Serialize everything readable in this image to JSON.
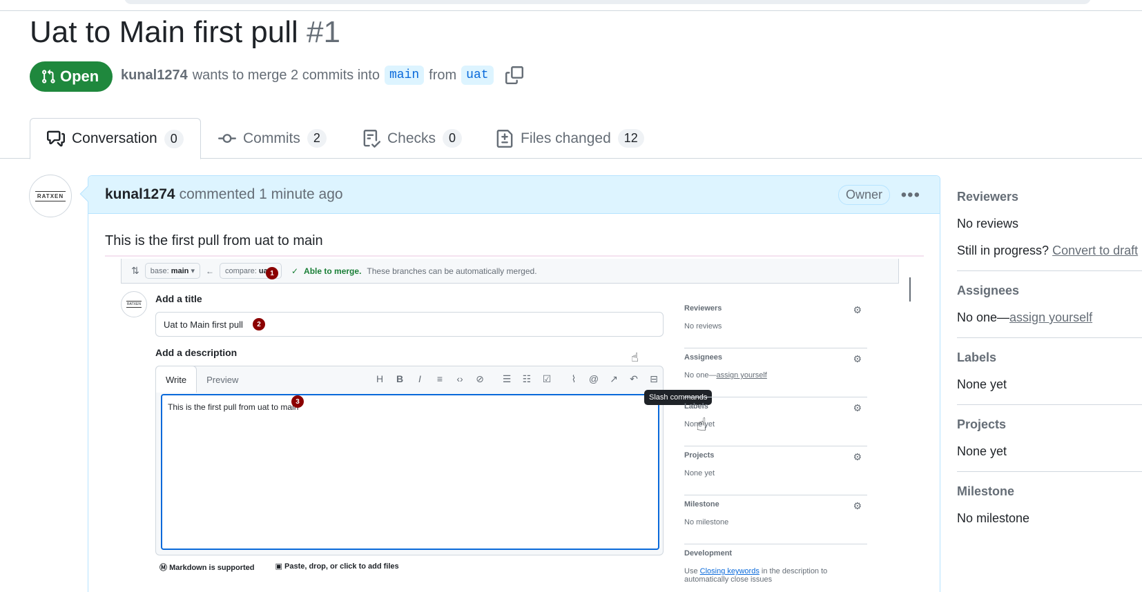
{
  "pr": {
    "title": "Uat to Main first pull",
    "number": "#1",
    "state": "Open",
    "author": "kunal1274",
    "merge_text": "wants to merge 2 commits into",
    "base_branch": "main",
    "from_text": "from",
    "head_branch": "uat"
  },
  "tabs": [
    {
      "label": "Conversation",
      "count": "0"
    },
    {
      "label": "Commits",
      "count": "2"
    },
    {
      "label": "Checks",
      "count": "0"
    },
    {
      "label": "Files changed",
      "count": "12"
    }
  ],
  "comment": {
    "author": "kunal1274",
    "action": "commented 1 minute ago",
    "role": "Owner",
    "body": "This is the first pull from uat to main",
    "avatar_text": "RATXEN"
  },
  "screenshot": {
    "base_label": "base:",
    "base_value": "main",
    "compare_label": "compare:",
    "compare_value": "uat",
    "merge_status": "Able to merge.",
    "merge_note": "These branches can be automatically merged.",
    "add_title": "Add a title",
    "title_value": "Uat to Main first pull",
    "add_description": "Add a description",
    "tab_write": "Write",
    "tab_preview": "Preview",
    "description_value": "This is the first pull from uat to main",
    "tooltip": "Slash commands",
    "markdown_note": "Markdown is supported",
    "files_note": "Paste, drop, or click to add files",
    "badges": [
      "1",
      "2",
      "3"
    ],
    "side": [
      {
        "title": "Reviewers",
        "value": "No reviews"
      },
      {
        "title": "Assignees",
        "value": "No one—",
        "link": "assign yourself"
      },
      {
        "title": "Labels",
        "value": "None yet"
      },
      {
        "title": "Projects",
        "value": "None yet"
      },
      {
        "title": "Milestone",
        "value": "No milestone"
      }
    ],
    "development_title": "Development",
    "development_pre": "Use",
    "development_link": "Closing keywords",
    "development_post": "in the description to automatically close issues"
  },
  "sidebar": {
    "reviewers_title": "Reviewers",
    "reviewers_value": "No reviews",
    "in_progress": "Still in progress?",
    "convert_link": "Convert to draft",
    "assignees_title": "Assignees",
    "assignees_value": "No one—",
    "assign_link": "assign yourself",
    "labels_title": "Labels",
    "labels_value": "None yet",
    "projects_title": "Projects",
    "projects_value": "None yet",
    "milestone_title": "Milestone",
    "milestone_value": "No milestone"
  },
  "colors": {
    "open_green": "#1f883d",
    "link_blue": "#0969da",
    "comment_header": "#ddf4ff",
    "badge_red": "#8b0000"
  }
}
